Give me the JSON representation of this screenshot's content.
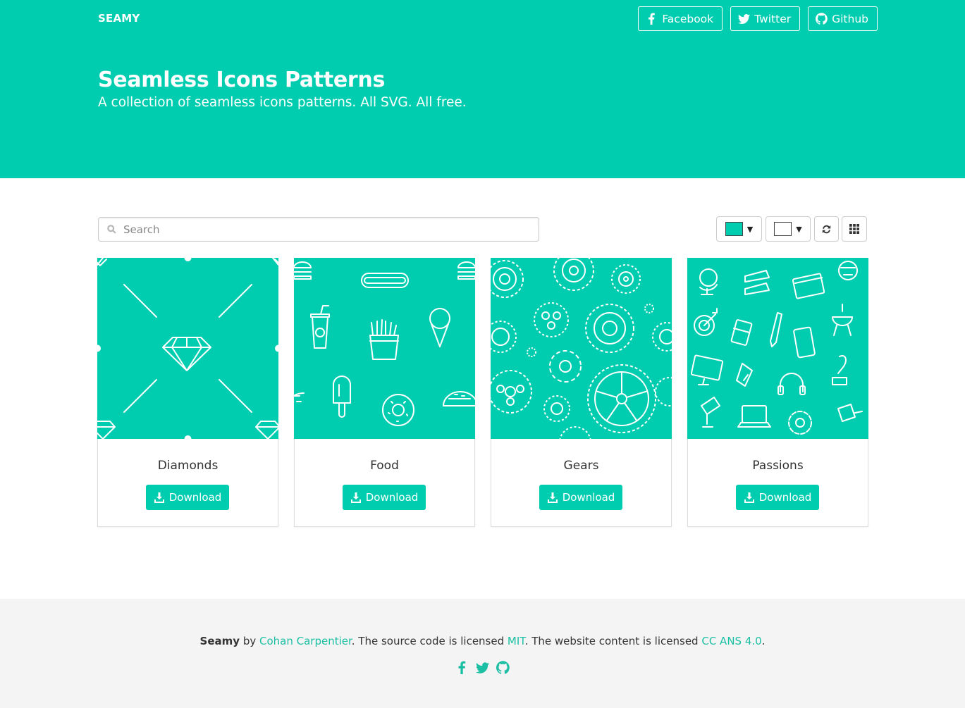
{
  "header": {
    "brand": "SEAMY",
    "title": "Seamless Icons Patterns",
    "subtitle": "A collection of seamless icons patterns. All SVG. All free.",
    "social": [
      {
        "label": "Facebook",
        "icon": "facebook-icon"
      },
      {
        "label": "Twitter",
        "icon": "twitter-icon"
      },
      {
        "label": "Github",
        "icon": "github-icon"
      }
    ]
  },
  "toolbar": {
    "search_placeholder": "Search",
    "search_value": "",
    "foreground_color": "#00cdaf",
    "background_color": "#ffffff"
  },
  "accent_color": "#00cdaf",
  "patterns": [
    {
      "name": "Diamonds",
      "download_label": "Download"
    },
    {
      "name": "Food",
      "download_label": "Download"
    },
    {
      "name": "Gears",
      "download_label": "Download"
    },
    {
      "name": "Passions",
      "download_label": "Download"
    }
  ],
  "footer": {
    "brand": "Seamy",
    "by": " by ",
    "author": "Cohan Carpentier",
    "source_text": ". The source code is licensed ",
    "source_license": "MIT",
    "content_text": ". The website content is licensed ",
    "content_license": "CC ANS 4.0",
    "end": "."
  }
}
